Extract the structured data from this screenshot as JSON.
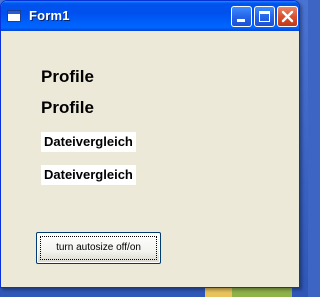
{
  "window": {
    "title": "Form1"
  },
  "labels": {
    "profile_1": "Profile",
    "profile_2": "Profile",
    "dateivergleich_1": "Dateivergleich",
    "dateivergleich_2": "Dateivergleich"
  },
  "buttons": {
    "autosize_toggle": "turn autosize off/on"
  },
  "icons": {
    "app": "window-app-icon",
    "minimize": "minimize-icon",
    "maximize": "maximize-icon",
    "close": "close-icon"
  },
  "colors": {
    "titlebar": "#0054e3",
    "client_bg": "#ece9d8",
    "close_button": "#d8522e"
  }
}
